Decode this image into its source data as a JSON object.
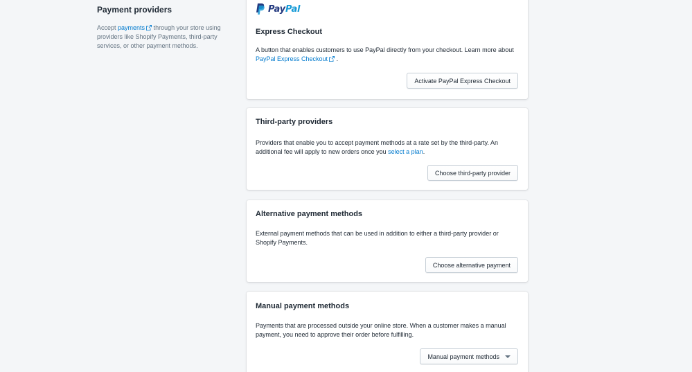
{
  "section": {
    "title": "Payment providers",
    "desc_before": "Accept",
    "desc_link": "payments",
    "desc_after": "through your store using providers like Shopify Payments, third-party services, or other payment methods."
  },
  "paypal": {
    "logo_text_pay": "Pay",
    "logo_text_pal": "Pal",
    "title": "Express Checkout",
    "desc_before": "A button that enables customers to use PayPal directly from your checkout. Learn more about",
    "desc_link": "PayPal Express Checkout",
    "desc_after": ".",
    "button": "Activate PayPal Express Checkout",
    "icon": "external-link-icon"
  },
  "third_party": {
    "title": "Third-party providers",
    "desc_before": "Providers that enable you to accept payment methods at a rate set by the third-party. An additional fee will apply to new orders once you",
    "desc_link": "select a plan",
    "desc_after": ".",
    "button": "Choose third-party provider"
  },
  "alternative": {
    "title": "Alternative payment methods",
    "desc": "External payment methods that can be used in addition to either a third-party provider or Shopify Payments.",
    "button": "Choose alternative payment"
  },
  "manual": {
    "title": "Manual payment methods",
    "desc": "Payments that are processed outside your online store. When a customer makes a manual payment, you need to approve their order before fulfilling.",
    "button": "Manual payment methods",
    "icon": "caret-down-icon"
  },
  "colors": {
    "background": "#f4f6f8",
    "link": "#007ace",
    "text": "#212b36",
    "subdued": "#637381",
    "paypal_dark": "#253b80",
    "paypal_light": "#179bd7"
  }
}
